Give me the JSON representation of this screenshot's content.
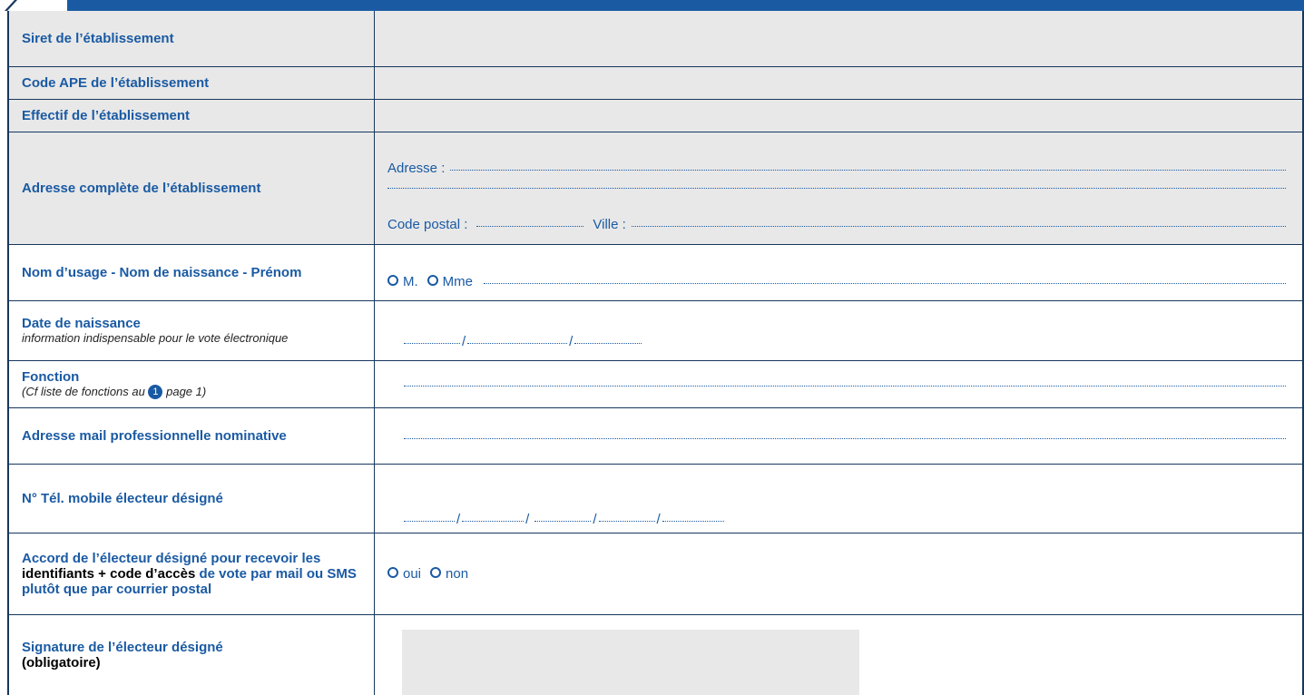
{
  "form": {
    "rows": {
      "siret": {
        "label": "Siret de l’établissement"
      },
      "ape": {
        "label": "Code APE de l’établissement"
      },
      "effectif": {
        "label": "Effectif de l’établissement"
      },
      "adresse": {
        "label": "Adresse complète de l’établissement",
        "adresse_label": "Adresse :",
        "cp_label": "Code postal :",
        "ville_label": "Ville :"
      },
      "nom": {
        "label": "Nom d’usage - Nom de naissance - Prénom",
        "option_m": "M.",
        "option_mme": "Mme"
      },
      "naissance": {
        "label": "Date de naissance",
        "note": "information indispensable pour le vote électronique",
        "sep": "/"
      },
      "fonction": {
        "label": "Fonction",
        "note_before": "(Cf liste de fonctions au",
        "note_num": "1",
        "note_after": "page 1)"
      },
      "mail": {
        "label": "Adresse mail professionnelle nominative"
      },
      "tel": {
        "label": "N° Tél. mobile électeur désigné",
        "sep": "/"
      },
      "accord": {
        "label_part1": "Accord de l’électeur désigné pour recevoir les",
        "label_part2": "identifiants + code d’accès",
        "label_part3": "de vote par mail ou SMS plutôt que par courrier postal",
        "option_oui": "oui",
        "option_non": "non"
      },
      "signature": {
        "label": "Signature de l’électeur désigné",
        "note": "(obligatoire)"
      }
    }
  }
}
